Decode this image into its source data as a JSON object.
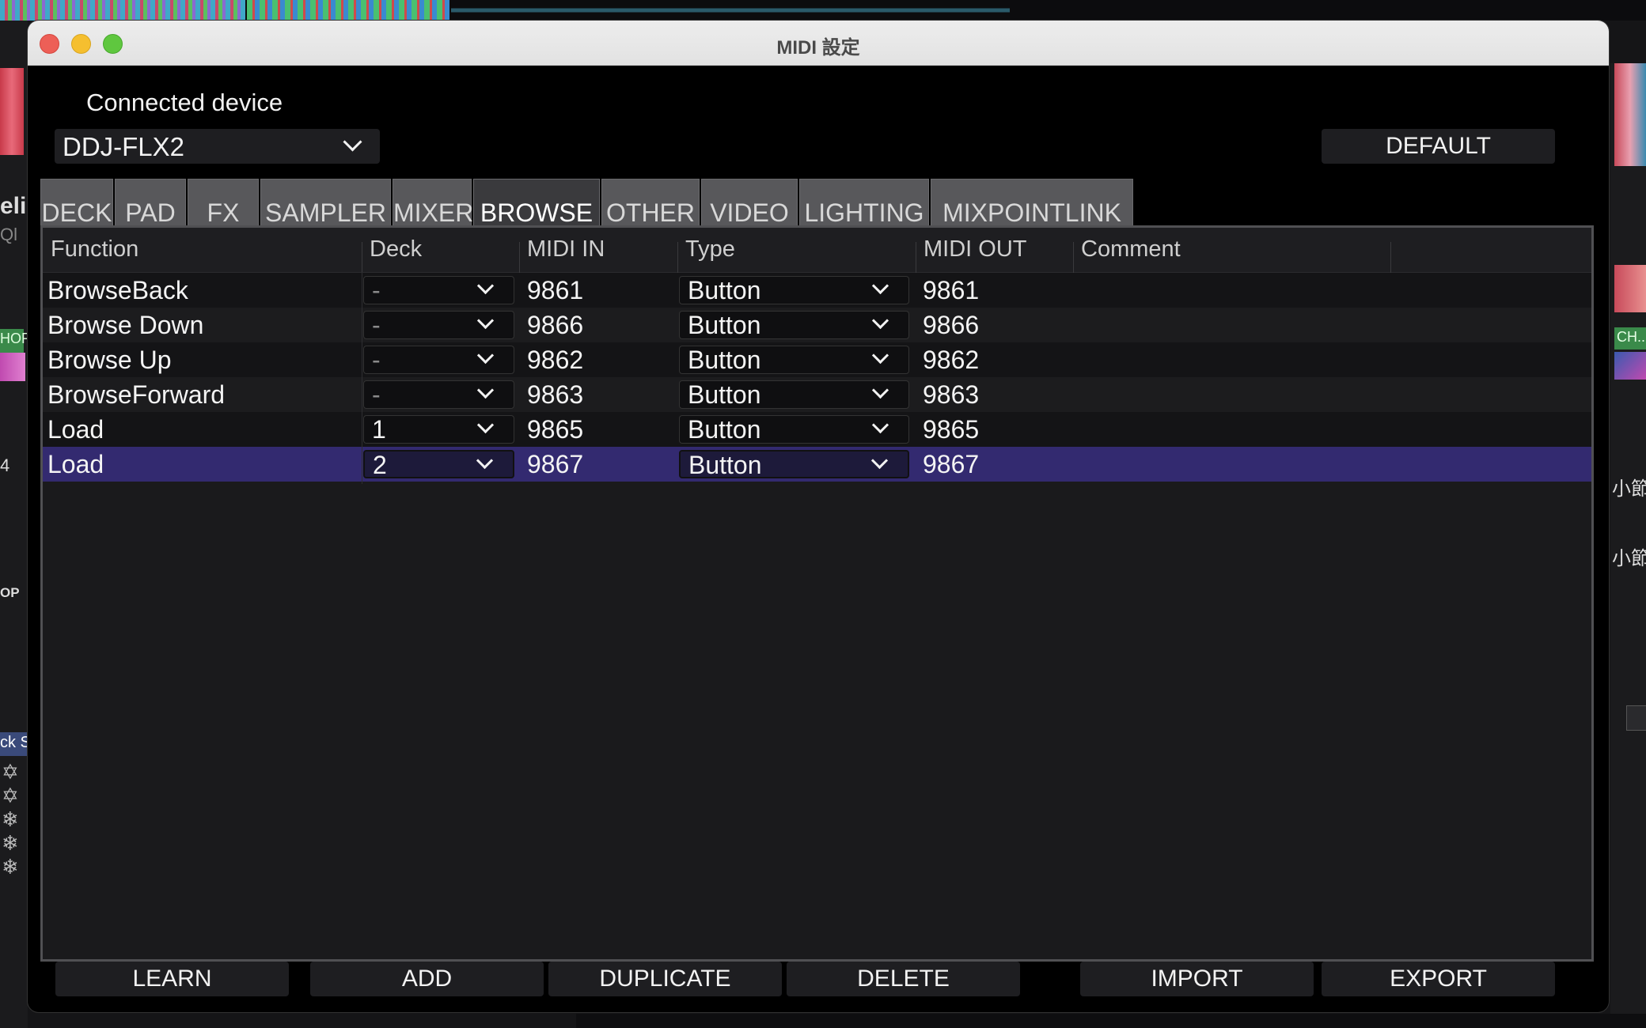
{
  "background": {
    "left_texts": [
      "eli",
      "Ql",
      "HOR",
      "4",
      "OP",
      "ck S"
    ],
    "right_texts": [
      "CH...",
      "小節前",
      "小節"
    ]
  },
  "window": {
    "title": "MIDI 設定",
    "connected_label": "Connected device",
    "device_value": "DDJ-FLX2",
    "default_label": "DEFAULT"
  },
  "tabs": [
    {
      "label": "DECK",
      "active": false
    },
    {
      "label": "PAD",
      "active": false
    },
    {
      "label": "FX",
      "active": false
    },
    {
      "label": "SAMPLER",
      "active": false
    },
    {
      "label": "MIXER",
      "active": false
    },
    {
      "label": "BROWSE",
      "active": true
    },
    {
      "label": "OTHER",
      "active": false
    },
    {
      "label": "VIDEO",
      "active": false
    },
    {
      "label": "LIGHTING",
      "active": false
    },
    {
      "label": "MIXPOINTLINK",
      "active": false
    }
  ],
  "table": {
    "columns": [
      "Function",
      "Deck",
      "MIDI IN",
      "Type",
      "MIDI OUT",
      "Comment"
    ],
    "rows": [
      {
        "function": "BrowseBack",
        "deck": "-",
        "midi_in": "9861",
        "type": "Button",
        "midi_out": "9861",
        "comment": ""
      },
      {
        "function": "Browse Down",
        "deck": "-",
        "midi_in": "9866",
        "type": "Button",
        "midi_out": "9866",
        "comment": ""
      },
      {
        "function": "Browse Up",
        "deck": "-",
        "midi_in": "9862",
        "type": "Button",
        "midi_out": "9862",
        "comment": ""
      },
      {
        "function": "BrowseForward",
        "deck": "-",
        "midi_in": "9863",
        "type": "Button",
        "midi_out": "9863",
        "comment": ""
      },
      {
        "function": "Load",
        "deck": "1",
        "midi_in": "9865",
        "type": "Button",
        "midi_out": "9865",
        "comment": ""
      },
      {
        "function": "Load",
        "deck": "2",
        "midi_in": "9867",
        "type": "Button",
        "midi_out": "9867",
        "comment": ""
      }
    ],
    "selected_row": 5
  },
  "buttons": {
    "learn": "LEARN",
    "add": "ADD",
    "duplicate": "DUPLICATE",
    "delete": "DELETE",
    "import": "IMPORT",
    "export": "EXPORT"
  },
  "colors": {
    "selected_row": "#332a70",
    "active_tab": "#3a3a3d",
    "inactive_tab": "#58585b"
  }
}
